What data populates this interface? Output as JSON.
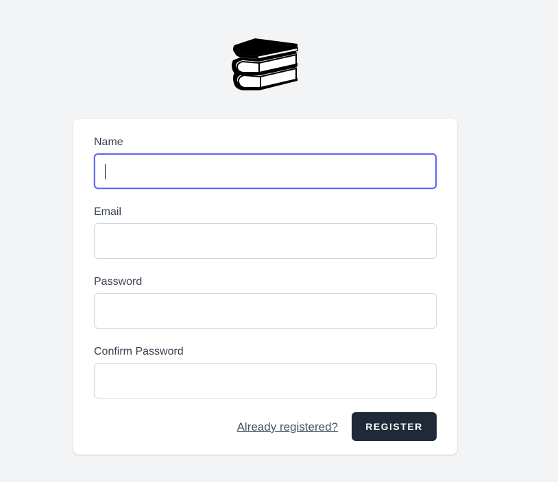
{
  "logo": {
    "icon": "books-icon"
  },
  "form": {
    "fields": [
      {
        "label": "Name",
        "value": "",
        "placeholder": ""
      },
      {
        "label": "Email",
        "value": "",
        "placeholder": ""
      },
      {
        "label": "Password",
        "value": "",
        "placeholder": ""
      },
      {
        "label": "Confirm Password",
        "value": "",
        "placeholder": ""
      }
    ],
    "login_link": "Already registered?",
    "submit_label": "REGISTER"
  },
  "colors": {
    "page_background": "#f3f4f6",
    "card_background": "#ffffff",
    "focus_ring": "#6366f1",
    "button_background": "#1f2937",
    "button_text": "#ffffff"
  }
}
